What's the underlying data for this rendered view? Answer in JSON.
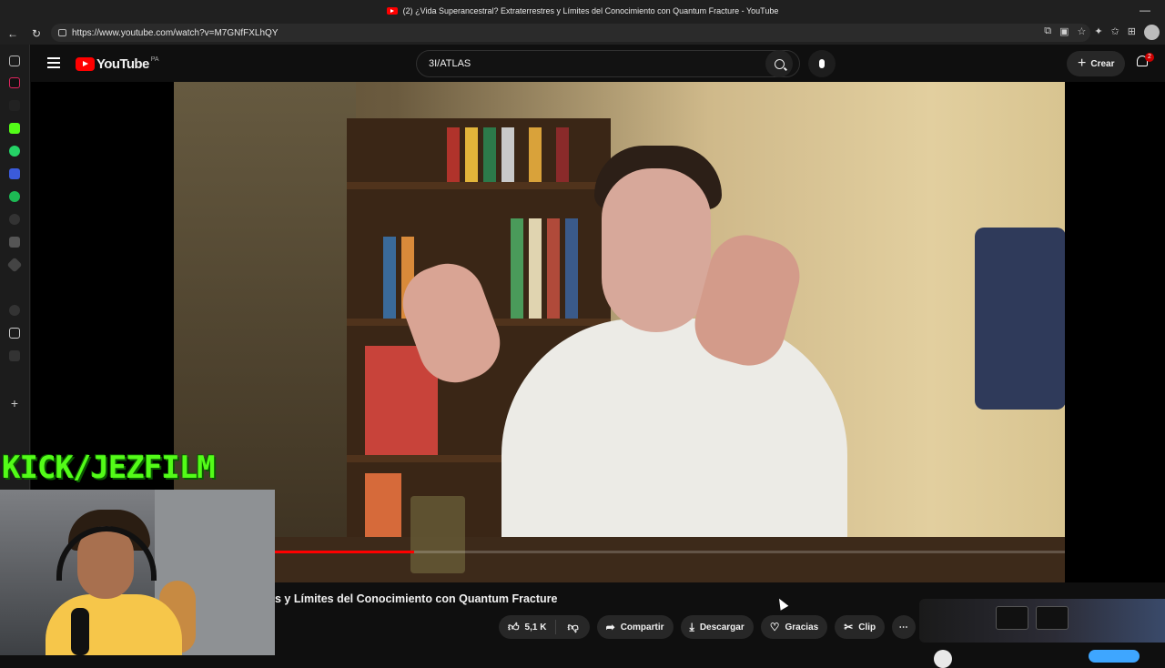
{
  "browser": {
    "tab_title": "(2) ¿Vida Superancestral? Extraterrestres y Límites del Conocimiento con Quantum Fracture - YouTube",
    "url": "https://www.youtube.com/watch?v=M7GNfFXLhQY"
  },
  "youtube": {
    "logo_text": "YouTube",
    "country_code": "PA",
    "search_value": "3I/ATLAS",
    "create_label": "Crear",
    "notification_count": "2"
  },
  "video": {
    "title_visible": "s y Límites del Conocimiento con Quantum Fracture",
    "progress": 0.27
  },
  "actions": {
    "likes": "5,1 K",
    "share": "Compartir",
    "download": "Descargar",
    "thanks": "Gracias",
    "clip": "Clip"
  },
  "overlay": {
    "kick_tag": "KICK/JEZFILM"
  },
  "colors": {
    "youtube_red": "#ff0000",
    "kick_green": "#53fc18"
  }
}
